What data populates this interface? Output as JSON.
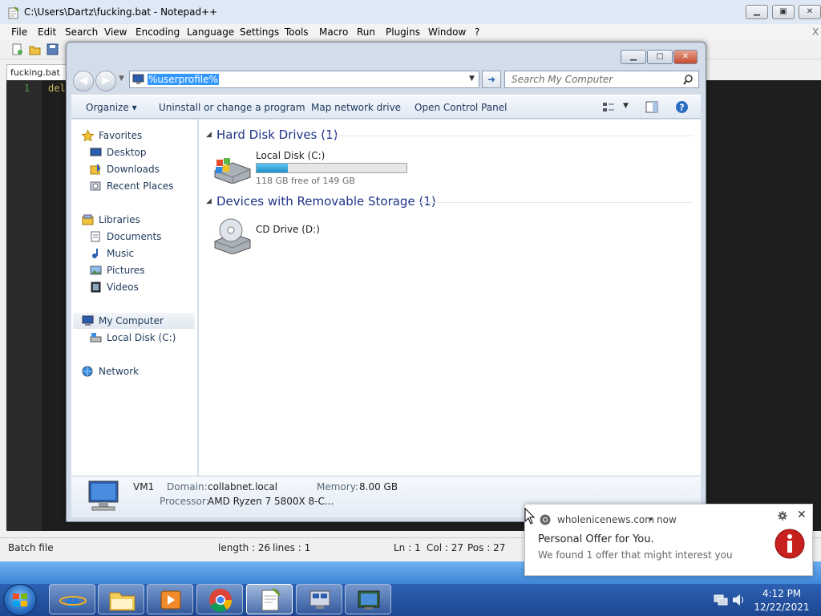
{
  "notepad": {
    "title": "C:\\Users\\Dartz\\fucking.bat - Notepad++",
    "menu": [
      "File",
      "Edit",
      "Search",
      "View",
      "Encoding",
      "Language",
      "Settings",
      "Tools",
      "Macro",
      "Run",
      "Plugins",
      "Window",
      "?"
    ],
    "close_x": "X",
    "tab_label": "fucking.bat",
    "line_number": "1",
    "code_text": "del",
    "status": {
      "filetype": "Batch file",
      "length": "length : 26",
      "lines": "lines : 1",
      "ln": "Ln : 1",
      "col": "Col : 27",
      "pos": "Pos : 27"
    }
  },
  "explorer": {
    "address_value": "%userprofile%",
    "search_placeholder": "Search My Computer",
    "commands": [
      "Organize",
      "Uninstall or change a program",
      "Map network drive",
      "Open Control Panel"
    ],
    "nav": {
      "favorites": "Favorites",
      "desktop": "Desktop",
      "downloads": "Downloads",
      "recent_places": "Recent Places",
      "libraries": "Libraries",
      "documents": "Documents",
      "music": "Music",
      "pictures": "Pictures",
      "videos": "Videos",
      "my_computer": "My Computer",
      "local_disk": "Local Disk (C:)",
      "network": "Network"
    },
    "groups": {
      "hdd_header": "Hard Disk Drives (1)",
      "removable_header": "Devices with Removable Storage (1)"
    },
    "drives": {
      "c_name": "Local Disk (C:)",
      "c_free": "118 GB free of 149 GB",
      "c_used_fraction": 0.21,
      "d_name": "CD Drive (D:)"
    },
    "details": {
      "name": "VM1",
      "domain_label": "Domain:",
      "domain_value": "collabnet.local",
      "memory_label": "Memory:",
      "memory_value": "8.00 GB",
      "processor_label": "Processor:",
      "processor_value": "AMD Ryzen 7 5800X 8-C..."
    }
  },
  "notification": {
    "source": "wholenicenews.com",
    "time": "now",
    "separator": "•",
    "title": "Personal Offer for You.",
    "body": "We found 1 offer that might interest you"
  },
  "taskbar": {
    "time": "4:12 PM",
    "date": "12/22/2021"
  }
}
